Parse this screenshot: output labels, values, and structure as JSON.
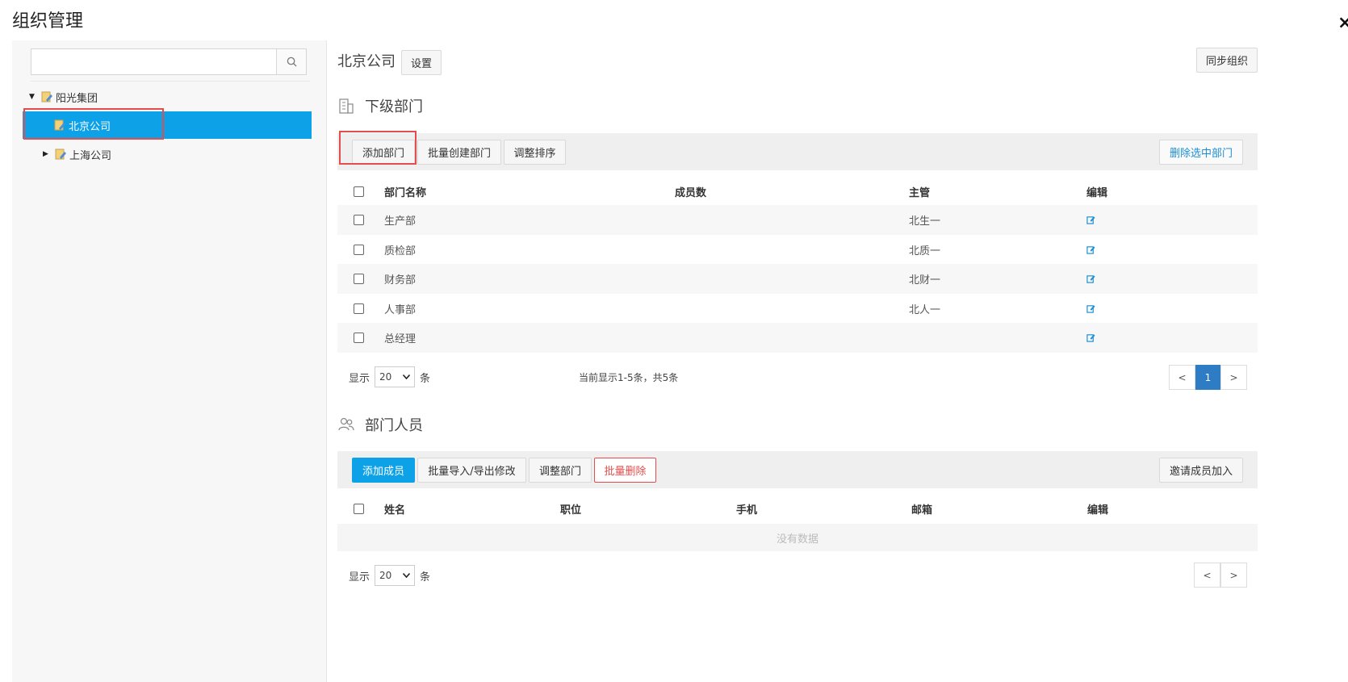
{
  "window": {
    "title": "组织管理",
    "close": "×"
  },
  "sidebar": {
    "search": {
      "value": "",
      "placeholder": ""
    },
    "tree": [
      {
        "label": "阳光集团",
        "expanded": true
      },
      {
        "label": "北京公司",
        "selected": true
      },
      {
        "label": "上海公司",
        "expanded": false
      }
    ]
  },
  "header": {
    "company": "北京公司",
    "settings_label": "设置",
    "sync_label": "同步组织"
  },
  "departments": {
    "title": "下级部门",
    "toolbar": {
      "add": "添加部门",
      "batch_create": "批量创建部门",
      "sort": "调整排序",
      "delete_selected": "删除选中部门"
    },
    "columns": [
      "部门名称",
      "成员数",
      "主管",
      "编辑"
    ],
    "rows": [
      {
        "name": "生产部",
        "members": "",
        "manager": "北生一"
      },
      {
        "name": "质检部",
        "members": "",
        "manager": "北质一"
      },
      {
        "name": "财务部",
        "members": "",
        "manager": "北财一"
      },
      {
        "name": "人事部",
        "members": "",
        "manager": "北人一"
      },
      {
        "name": "总经理",
        "members": "",
        "manager": ""
      }
    ],
    "pager": {
      "show": "显示",
      "page_size": "20",
      "unit": "条",
      "summary": "当前显示1-5条，共5条",
      "prev": "<",
      "current": "1",
      "next": ">"
    }
  },
  "members": {
    "title": "部门人员",
    "toolbar": {
      "add": "添加成员",
      "batch_import": "批量导入/导出修改",
      "adjust": "调整部门",
      "batch_delete": "批量删除",
      "invite": "邀请成员加入"
    },
    "columns": [
      "姓名",
      "职位",
      "手机",
      "邮箱",
      "编辑"
    ],
    "empty_text": "没有数据",
    "pager": {
      "show": "显示",
      "page_size": "20",
      "unit": "条",
      "prev": "<",
      "next": ">"
    }
  },
  "colors": {
    "accent": "#0da2e8",
    "danger": "#e34d4d",
    "page_active": "#2e7cc4"
  }
}
